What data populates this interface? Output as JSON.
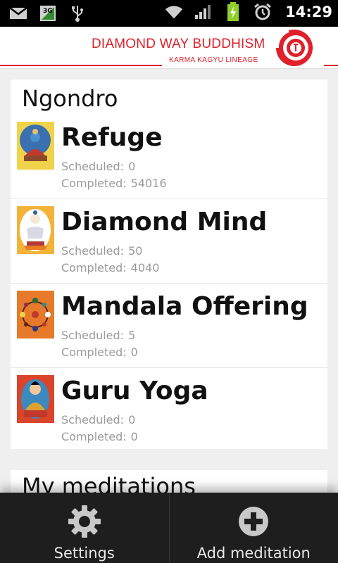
{
  "status_bar": {
    "time": "14:29",
    "network_label": "3G",
    "icons": [
      "gmail-icon",
      "3g-icon",
      "usb-icon",
      "wifi-icon",
      "signal-icon",
      "battery-charging-icon",
      "alarm-icon"
    ]
  },
  "brand": {
    "title": "DIAMOND WAY BUDDHISM",
    "subtitle": "KARMA KAGYU LINEAGE",
    "accent_color": "#e0202a"
  },
  "ngondro": {
    "title": "Ngondro",
    "scheduled_label": "Scheduled:",
    "completed_label": "Completed:",
    "items": [
      {
        "name": "Refuge",
        "scheduled": "0",
        "completed": "54016",
        "thumb_icon": "refuge-thangka"
      },
      {
        "name": "Diamond Mind",
        "scheduled": "50",
        "completed": "4040",
        "thumb_icon": "diamond-mind-thangka"
      },
      {
        "name": "Mandala Offering",
        "scheduled": "5",
        "completed": "0",
        "thumb_icon": "mandala-offering-thangka"
      },
      {
        "name": "Guru Yoga",
        "scheduled": "0",
        "completed": "0",
        "thumb_icon": "guru-yoga-thangka"
      }
    ]
  },
  "my_meditations": {
    "title": "My meditations"
  },
  "bottom_bar": {
    "settings_label": "Settings",
    "add_label": "Add meditation"
  }
}
